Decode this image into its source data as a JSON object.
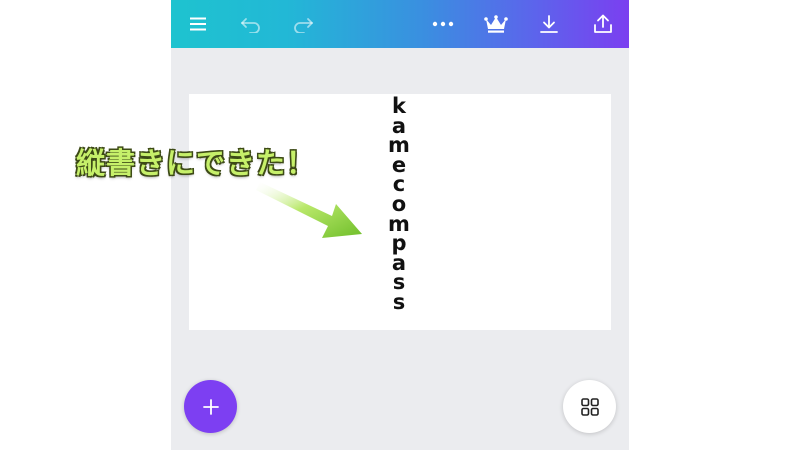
{
  "toolbar": {
    "icons": [
      "menu-icon",
      "undo-icon",
      "redo-icon",
      "more-icon",
      "crown-icon",
      "download-icon",
      "share-icon"
    ],
    "gradient": [
      "#1ec3cf",
      "#7b3ff0"
    ]
  },
  "canvas": {
    "vertical_text": [
      "k",
      "a",
      "m",
      "e",
      "c",
      "o",
      "m",
      "p",
      "a",
      "s",
      "s"
    ]
  },
  "annotation": {
    "text": "縦書きにできた！",
    "color": "#c6f06a"
  },
  "fab": {
    "add_icon": "plus-icon",
    "add_color": "#7d3ff2",
    "grid_icon": "grid-icon"
  }
}
